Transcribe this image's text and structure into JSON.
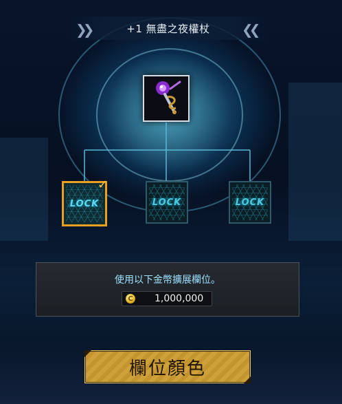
{
  "title": {
    "item_name": "+1 無盡之夜權杖"
  },
  "item": {
    "icon": "scepter-icon"
  },
  "slots": [
    {
      "label": "LOCK",
      "selected": true
    },
    {
      "label": "LOCK",
      "selected": false
    },
    {
      "label": "LOCK",
      "selected": false
    }
  ],
  "panel": {
    "message": "使用以下金幣擴展欄位。",
    "price": "1,000,000",
    "currency_icon": "gold-coin-icon",
    "currency_symbol": "C"
  },
  "action_button": {
    "label": "欄位顏色"
  },
  "colors": {
    "accent_gold": "#e8a020",
    "info_text": "#9de0ff",
    "lock_cyan": "#4fc8de"
  }
}
